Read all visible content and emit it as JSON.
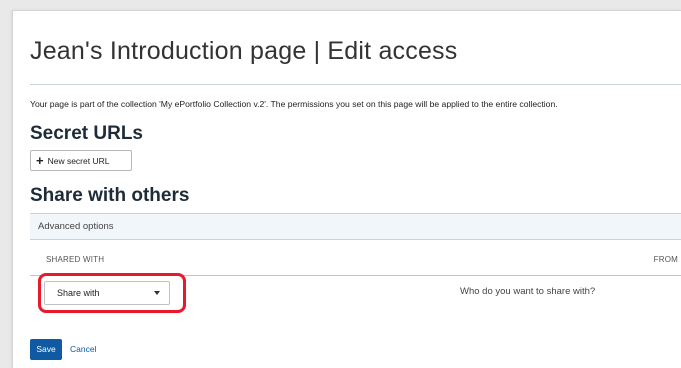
{
  "page": {
    "title": "Jean's Introduction page | Edit access",
    "notice": "Your page is part of the collection 'My ePortfolio Collection v.2'. The permissions you set on this page will be applied to the entire collection."
  },
  "secret_urls": {
    "heading": "Secret URLs",
    "new_button_label": "New secret URL",
    "new_button_icon": "plus-icon"
  },
  "share": {
    "heading": "Share with others",
    "advanced_options_label": "Advanced options",
    "columns": [
      "SHARED WITH",
      "FROM"
    ],
    "select_value": "Share with",
    "helper_text": "Who do you want to share with?"
  },
  "actions": {
    "save_label": "Save",
    "cancel_label": "Cancel"
  },
  "colors": {
    "primary": "#0f5aa3",
    "highlight": "#e8192c",
    "panel_bg": "#f1f6fa"
  }
}
